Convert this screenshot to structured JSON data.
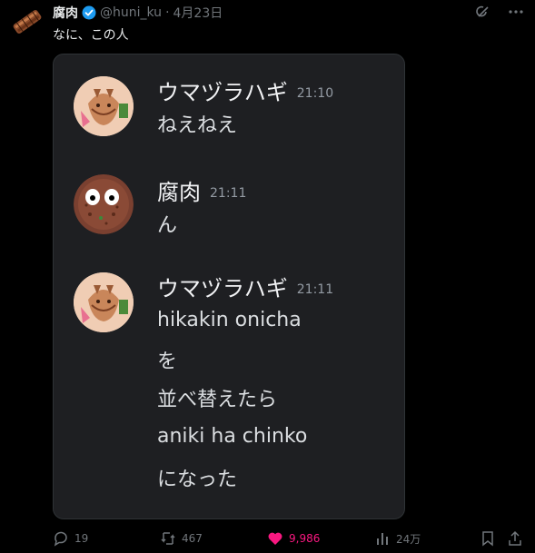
{
  "post": {
    "display_name": "腐肉",
    "handle": "@huni_ku",
    "separator": "·",
    "date": "4月23日",
    "text": "なに、この人"
  },
  "header_icons": [
    "grok-icon",
    "more-icon"
  ],
  "chat": {
    "messages": [
      {
        "author": "ウマヅラハギ",
        "time": "21:10",
        "lines": [
          "ねえねえ"
        ]
      },
      {
        "author": "腐肉",
        "time": "21:11",
        "lines": [
          "ん"
        ]
      },
      {
        "author": "ウマヅラハギ",
        "time": "21:11",
        "lines": [
          "hikakin onicha",
          "を",
          "並べ替えたら",
          "aniki ha chinko",
          "になった"
        ]
      }
    ]
  },
  "actions": {
    "replies": "19",
    "reposts": "467",
    "likes": "9,986",
    "views": "24万"
  },
  "colors": {
    "background": "#000000",
    "like_pink": "#f91880",
    "verified_blue": "#1d9bf0",
    "chat_bg": "#1e1f22"
  }
}
